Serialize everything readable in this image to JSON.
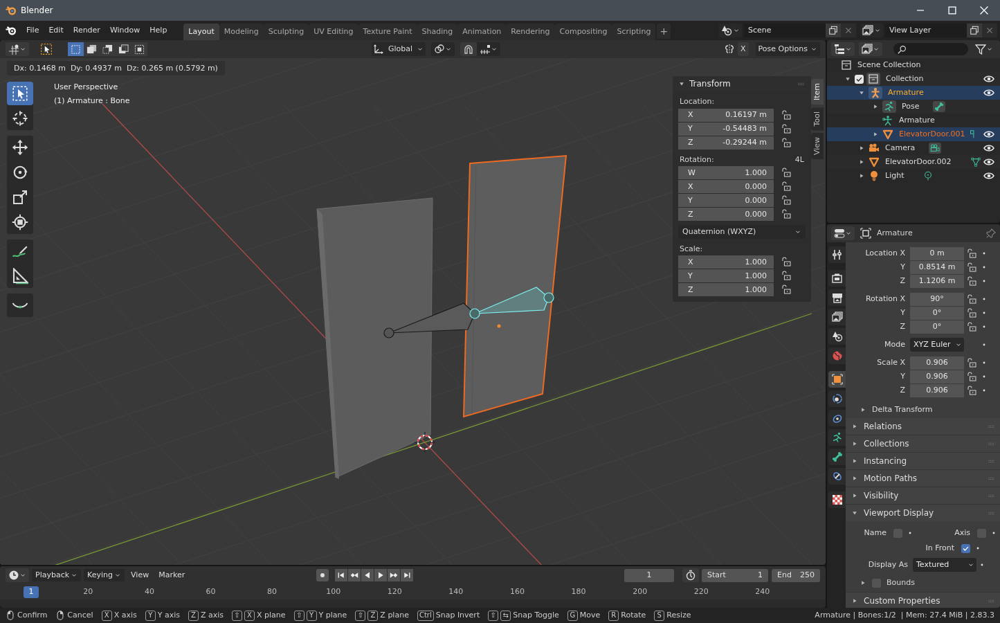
{
  "window": {
    "title": "Blender",
    "controls": [
      {
        "kind": "minimize"
      },
      {
        "kind": "maximize"
      },
      {
        "kind": "close"
      }
    ]
  },
  "menu": [
    "File",
    "Edit",
    "Render",
    "Window",
    "Help"
  ],
  "workspaces": [
    {
      "label": "Layout",
      "selected": true
    },
    {
      "label": "Modeling",
      "selected": false
    },
    {
      "label": "Sculpting",
      "selected": false
    },
    {
      "label": "UV Editing",
      "selected": false
    },
    {
      "label": "Texture Paint",
      "selected": false
    },
    {
      "label": "Shading",
      "selected": false
    },
    {
      "label": "Animation",
      "selected": false
    },
    {
      "label": "Rendering",
      "selected": false
    },
    {
      "label": "Compositing",
      "selected": false
    },
    {
      "label": "Scripting",
      "selected": false
    }
  ],
  "add_workspace": "+",
  "scene": "Scene",
  "view_layer": "View Layer",
  "viewport_header": {
    "select_modes": [
      {
        "kind": "set",
        "selected": true
      },
      {
        "kind": "extend",
        "selected": false
      },
      {
        "kind": "subtract",
        "selected": false
      },
      {
        "kind": "invert",
        "selected": false
      },
      {
        "kind": "intersect",
        "selected": false
      }
    ],
    "orientation": "Global",
    "mirror_label": "X",
    "pose_options": "Pose Options"
  },
  "operator_status": "Dx: 0.1468 m  Dy: 0.4937 m  Dz: 0.265 m (0.5792 m)",
  "tool_groups": [
    [
      {
        "kind": "select",
        "selected": true
      },
      {
        "kind": "cursor",
        "selected": false
      }
    ],
    [
      {
        "kind": "move",
        "selected": false
      },
      {
        "kind": "rotate",
        "selected": false
      },
      {
        "kind": "scale",
        "selected": false
      },
      {
        "kind": "transform",
        "selected": false
      }
    ],
    [
      {
        "kind": "annotate",
        "selected": false
      },
      {
        "kind": "measure",
        "selected": false
      }
    ],
    [
      {
        "kind": "roll",
        "selected": false
      }
    ]
  ],
  "viewport": {
    "view_name": "User Perspective",
    "active_object": "(1) Armature : Bone"
  },
  "n_panel": {
    "tabs": [
      {
        "label": "Item",
        "selected": true
      },
      {
        "label": "Tool",
        "selected": false
      },
      {
        "label": "View",
        "selected": false
      }
    ],
    "title": "Transform",
    "location_label": "Location:",
    "location": [
      {
        "axis": "X",
        "value": "0.16197 m"
      },
      {
        "axis": "Y",
        "value": "-0.54483 m"
      },
      {
        "axis": "Z",
        "value": "-0.29244 m"
      }
    ],
    "rotation_label": "Rotation:",
    "rotation_lock_label": "4L",
    "rotation": [
      {
        "axis": "W",
        "value": "1.000"
      },
      {
        "axis": "X",
        "value": "0.000"
      },
      {
        "axis": "Y",
        "value": "0.000"
      },
      {
        "axis": "Z",
        "value": "0.000"
      }
    ],
    "rotation_mode": "Quaternion (WXYZ)",
    "scale_label": "Scale:",
    "scale": [
      {
        "axis": "X",
        "value": "1.000"
      },
      {
        "axis": "Y",
        "value": "1.000"
      },
      {
        "axis": "Z",
        "value": "1.000"
      }
    ]
  },
  "timeline": {
    "menus": [
      {
        "label": "Playback",
        "kind": "dropdown"
      },
      {
        "label": "Keying",
        "kind": "dropdown"
      },
      {
        "label": "View",
        "kind": "menu"
      },
      {
        "label": "Marker",
        "kind": "menu"
      }
    ],
    "transport": [
      {
        "kind": "record"
      },
      {
        "kind": "jump_start"
      },
      {
        "kind": "prev_key"
      },
      {
        "kind": "play_reverse"
      },
      {
        "kind": "play"
      },
      {
        "kind": "next_key"
      },
      {
        "kind": "jump_end"
      }
    ],
    "current_frame": "1",
    "start_label": "Start",
    "start": "1",
    "end_label": "End",
    "end": "250",
    "playhead": "1",
    "ticks": [
      "20",
      "40",
      "60",
      "80",
      "100",
      "120",
      "140",
      "160",
      "180",
      "200",
      "220",
      "240"
    ]
  },
  "outliner": {
    "items": [
      {
        "label": "Scene Collection",
        "kind": "scene_collection",
        "selected": false,
        "active": false,
        "children": [
          {
            "label": "Collection",
            "kind": "collection",
            "checked": true,
            "expanded": true,
            "visible": true,
            "selected": false,
            "active": false,
            "children": [
              {
                "label": "Armature",
                "kind": "armature",
                "expanded": true,
                "visible": true,
                "selected": true,
                "active": true,
                "children": [
                  {
                    "label": "Pose",
                    "kind": "pose",
                    "expanded": false,
                    "badge": {
                      "kind": "bone"
                    },
                    "selected": false,
                    "active": false
                  },
                  {
                    "label": "Armature",
                    "kind": "armature_data",
                    "selected": false,
                    "active": false
                  },
                  {
                    "label": "ElevatorDoor.001",
                    "kind": "mesh",
                    "expanded": false,
                    "badge": {
                      "kind": "vertex_group"
                    },
                    "visible": true,
                    "selected": true,
                    "active": false
                  }
                ]
              },
              {
                "label": "Camera",
                "kind": "camera",
                "expanded": false,
                "badge": {
                  "kind": "camera"
                },
                "visible": true,
                "selected": false,
                "active": false
              },
              {
                "label": "ElevatorDoor.002",
                "kind": "mesh",
                "expanded": false,
                "badge": {
                  "kind": "mesh"
                },
                "visible": true,
                "selected": false,
                "active": false
              },
              {
                "label": "Light",
                "kind": "light",
                "expanded": false,
                "badge": {
                  "kind": "light"
                },
                "visible": true,
                "selected": false,
                "active": false
              }
            ]
          }
        ]
      }
    ]
  },
  "properties": {
    "tab_groups": [
      [
        {
          "kind": "tool",
          "selected": false
        }
      ],
      [
        {
          "kind": "render",
          "selected": false
        },
        {
          "kind": "output",
          "selected": false
        },
        {
          "kind": "view_layer",
          "selected": false
        },
        {
          "kind": "scene",
          "selected": false
        },
        {
          "kind": "world",
          "selected": false
        }
      ],
      [
        {
          "kind": "object",
          "selected": true
        },
        {
          "kind": "physics",
          "selected": false
        },
        {
          "kind": "constraints",
          "selected": false
        },
        {
          "kind": "data",
          "selected": false
        },
        {
          "kind": "bone",
          "selected": false
        },
        {
          "kind": "bone_constraints",
          "selected": false
        }
      ],
      [
        {
          "kind": "texture",
          "selected": false
        }
      ]
    ],
    "object_name": "Armature",
    "transform_groups": [
      [
        {
          "label": "Location X",
          "value": "0 m",
          "kind": "number"
        },
        {
          "label": "Y",
          "value": "0.8514 m",
          "kind": "number"
        },
        {
          "label": "Z",
          "value": "1.1206 m",
          "kind": "number"
        }
      ],
      [
        {
          "label": "Rotation X",
          "value": "90°",
          "kind": "number"
        },
        {
          "label": "Y",
          "value": "0°",
          "kind": "number"
        },
        {
          "label": "Z",
          "value": "0°",
          "kind": "number"
        }
      ],
      [
        {
          "label": "Mode",
          "value": "XYZ Euler",
          "kind": "dropdown"
        }
      ],
      [
        {
          "label": "Scale X",
          "value": "0.906",
          "kind": "number"
        },
        {
          "label": "Y",
          "value": "0.906",
          "kind": "number"
        },
        {
          "label": "Z",
          "value": "0.906",
          "kind": "number"
        }
      ]
    ],
    "delta": {
      "title": "Delta Transform",
      "expanded": false
    },
    "panels": [
      {
        "title": "Relations",
        "expanded": false
      },
      {
        "title": "Collections",
        "expanded": false
      },
      {
        "title": "Instancing",
        "expanded": false
      },
      {
        "title": "Motion Paths",
        "expanded": false
      },
      {
        "title": "Visibility",
        "expanded": false
      },
      {
        "title": "Viewport Display",
        "expanded": true,
        "checks": [
          {
            "label": "Name",
            "checked": false
          },
          {
            "label": "Axis",
            "checked": false
          },
          {
            "label": "In Front",
            "checked": true
          }
        ],
        "display_as_label": "Display As",
        "display_as": "Textured",
        "bounds": {
          "label": "Bounds",
          "checked": false,
          "expanded": false
        }
      },
      {
        "title": "Custom Properties",
        "expanded": false
      }
    ]
  },
  "status_bar": {
    "hints": [
      {
        "keys": [
          {
            "kind": "mouse_left"
          }
        ],
        "label": "Confirm"
      },
      {
        "keys": [
          {
            "kind": "mouse_right"
          }
        ],
        "label": "Cancel"
      },
      {
        "keys": [
          {
            "kind": "key",
            "text": "X"
          }
        ],
        "label": "X axis"
      },
      {
        "keys": [
          {
            "kind": "key",
            "text": "Y"
          }
        ],
        "label": "Y axis"
      },
      {
        "keys": [
          {
            "kind": "key",
            "text": "Z"
          }
        ],
        "label": "Z axis"
      },
      {
        "keys": [
          {
            "kind": "key",
            "text": "⇧"
          },
          {
            "kind": "key",
            "text": "X"
          }
        ],
        "label": "X plane"
      },
      {
        "keys": [
          {
            "kind": "key",
            "text": "⇧"
          },
          {
            "kind": "key",
            "text": "Y"
          }
        ],
        "label": "Y plane"
      },
      {
        "keys": [
          {
            "kind": "key",
            "text": "⇧"
          },
          {
            "kind": "key",
            "text": "Z"
          }
        ],
        "label": "Z plane"
      },
      {
        "keys": [
          {
            "kind": "key",
            "text": "Ctrl"
          }
        ],
        "label": "Snap Invert"
      },
      {
        "keys": [
          {
            "kind": "key",
            "text": "⇧"
          },
          {
            "kind": "key",
            "text": "⇆"
          }
        ],
        "label": "Snap Toggle"
      },
      {
        "keys": [
          {
            "kind": "key",
            "text": "G"
          }
        ],
        "label": "Move"
      },
      {
        "keys": [
          {
            "kind": "key",
            "text": "R"
          }
        ],
        "label": "Rotate"
      },
      {
        "keys": [
          {
            "kind": "key",
            "text": "S"
          }
        ],
        "label": "Resize"
      }
    ],
    "info": "Armature | Bones:1/2  | Mem: 27.4 MiB | 2.83.3"
  }
}
